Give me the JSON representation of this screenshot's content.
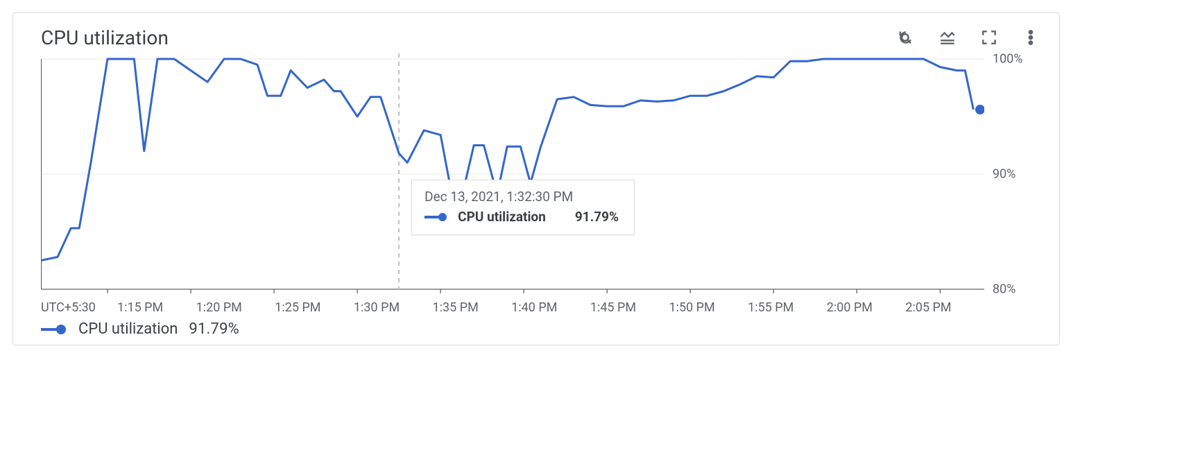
{
  "header": {
    "title": "CPU utilization"
  },
  "toolbar": {
    "icons": {
      "reset_zoom": "reset-zoom-icon",
      "legend_toggle": "legend-toggle-icon",
      "fullscreen": "fullscreen-icon",
      "more": "more-vert-icon"
    }
  },
  "tooltip": {
    "timestamp": "Dec 13, 2021, 1:32:30 PM",
    "series_label": "CPU utilization",
    "value": "91.79%"
  },
  "legend": {
    "series_label": "CPU utilization",
    "value": "91.79%"
  },
  "axes": {
    "timezone_label": "UTC+5:30",
    "x_ticks": [
      "1:15 PM",
      "1:20 PM",
      "1:25 PM",
      "1:30 PM",
      "1:35 PM",
      "1:40 PM",
      "1:45 PM",
      "1:50 PM",
      "1:55 PM",
      "2:00 PM",
      "2:05 PM"
    ],
    "y_ticks": [
      "100%",
      "90%",
      "80%"
    ]
  },
  "colors": {
    "series": "#3366cc",
    "grid": "#e8eaed",
    "muted": "#5f6368",
    "border": "#dadce0"
  },
  "chart_data": {
    "type": "line",
    "title": "CPU utilization",
    "xlabel": "UTC+5:30",
    "ylabel": "",
    "ylim": [
      80,
      100
    ],
    "x_unit": "minutes after 1:11 PM, Dec 13 2021",
    "crosshair_x_min": 21.5,
    "series": [
      {
        "name": "CPU utilization",
        "x": [
          0,
          1,
          1.8,
          2.3,
          3,
          4,
          4.6,
          5.2,
          5.6,
          6.2,
          7,
          8,
          9,
          10,
          11,
          12,
          13,
          13.6,
          14.4,
          15,
          16,
          17,
          17.6,
          18,
          19,
          19.8,
          20.4,
          21.5,
          22,
          23,
          24,
          24.6,
          25.4,
          26,
          26.6,
          27.4,
          28,
          28.8,
          29.4,
          30,
          31,
          32,
          33,
          34,
          35,
          36,
          37,
          38,
          39,
          40,
          41,
          42,
          43,
          44,
          45,
          46,
          47,
          48,
          49,
          50,
          51,
          52,
          53,
          54,
          55,
          55.5,
          56,
          56.4
        ],
        "values": [
          82.5,
          82.8,
          85.3,
          85.3,
          91.0,
          100,
          100,
          100,
          100,
          92.0,
          100,
          100,
          99.0,
          98.0,
          100,
          100,
          99.5,
          96.8,
          96.8,
          99.0,
          97.5,
          98.2,
          97.2,
          97.2,
          95.0,
          96.7,
          96.7,
          91.8,
          91.0,
          93.8,
          93.4,
          88.8,
          88.8,
          92.5,
          92.5,
          88.2,
          92.4,
          92.4,
          89.2,
          92.3,
          96.5,
          96.7,
          96.0,
          95.9,
          95.9,
          96.4,
          96.3,
          96.4,
          96.8,
          96.8,
          97.2,
          97.8,
          98.5,
          98.4,
          99.8,
          99.8,
          100,
          100,
          100,
          100,
          100,
          100,
          100,
          99.3,
          99.0,
          99.0,
          95.6
        ]
      }
    ]
  }
}
